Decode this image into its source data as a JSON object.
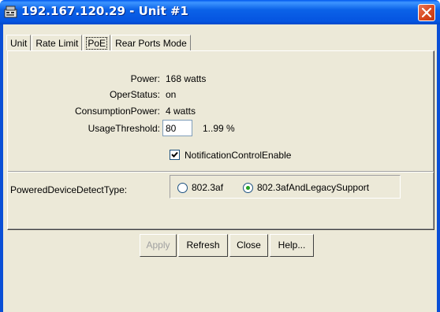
{
  "window": {
    "title": "192.167.120.29 - Unit #1"
  },
  "tabs": [
    {
      "label": "Unit"
    },
    {
      "label": "Rate Limit"
    },
    {
      "label": "PoE"
    },
    {
      "label": "Rear Ports Mode"
    }
  ],
  "poe": {
    "power_label": "Power:",
    "power_value": "168 watts",
    "oper_status_label": "OperStatus:",
    "oper_status_value": "on",
    "consumption_label": "ConsumptionPower:",
    "consumption_value": "4 watts",
    "usage_threshold_label": "UsageThreshold:",
    "usage_threshold_value": "80",
    "usage_threshold_range": "1..99 %",
    "notification_label": "NotificationControlEnable",
    "notification_checked": true,
    "detect_type_label": "PoweredDeviceDetectType:",
    "detect_options": [
      {
        "label": "802.3af",
        "selected": false
      },
      {
        "label": "802.3afAndLegacySupport",
        "selected": true
      }
    ]
  },
  "buttons": {
    "apply": "Apply",
    "refresh": "Refresh",
    "close": "Close",
    "help": "Help..."
  },
  "colors": {
    "titlebar": "#0554e0",
    "client_bg": "#ece9d8",
    "close_button": "#d8491f"
  }
}
